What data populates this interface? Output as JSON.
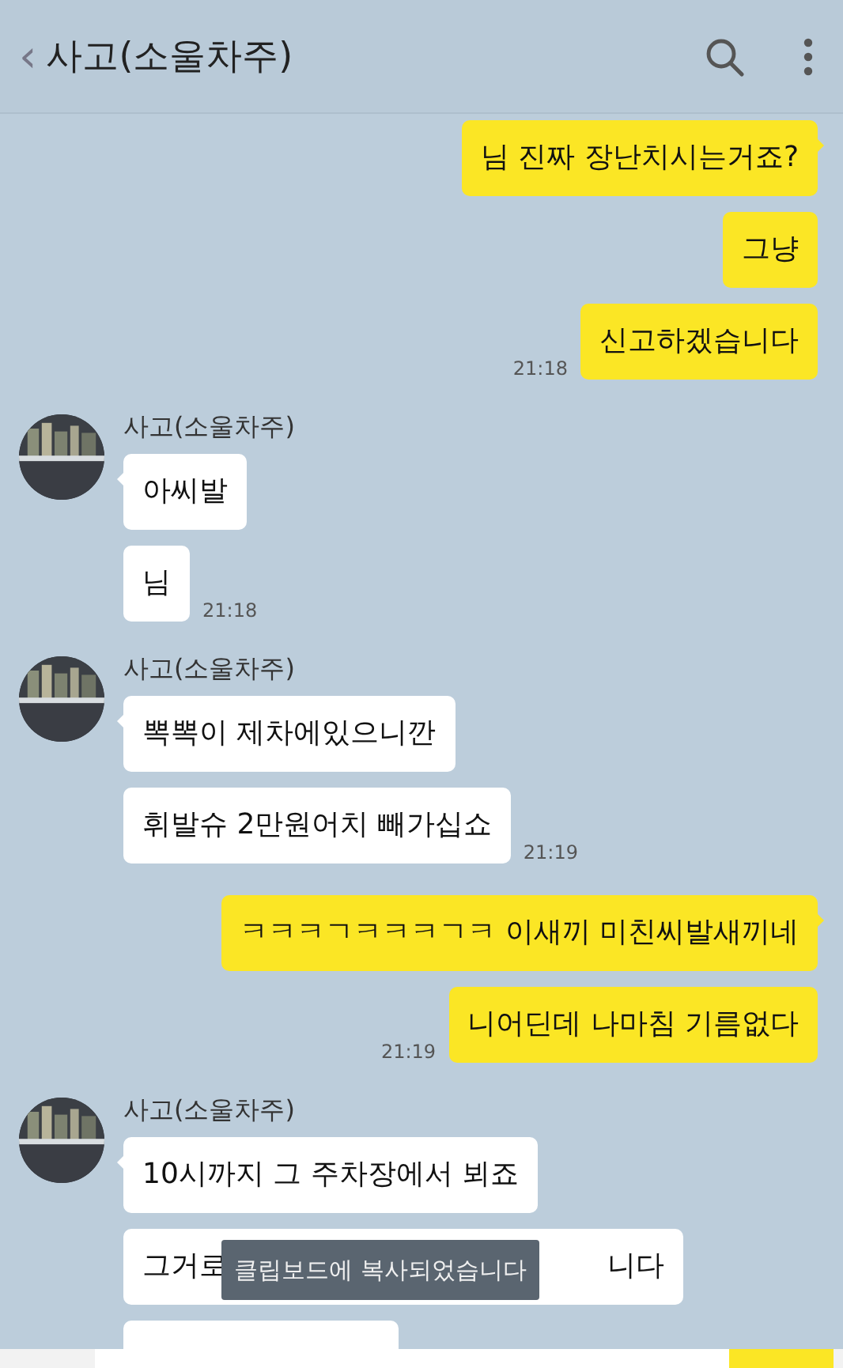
{
  "header": {
    "back": "‹",
    "title": "사고(소울차주)"
  },
  "chat": [
    {
      "kind": "sent",
      "messages": [
        {
          "text": "님 진짜 장난치시는거죠?"
        },
        {
          "text": "그냥"
        },
        {
          "text": "신고하겠습니다",
          "time": "21:18"
        }
      ]
    },
    {
      "kind": "received",
      "sender": "사고(소울차주)",
      "avatar": {
        "kind": "picture"
      },
      "messages": [
        {
          "text": "아씨발"
        },
        {
          "text": "님",
          "time": "21:18"
        }
      ]
    },
    {
      "kind": "received",
      "sender": "사고(소울차주)",
      "avatar": {
        "kind": "picture"
      },
      "messages": [
        {
          "text": "뽁뽁이 제차에있으니깐"
        },
        {
          "text": "휘발슈 2만원어치 빼가십쇼",
          "time": "21:19"
        }
      ]
    },
    {
      "kind": "sent",
      "messages": [
        {
          "text": "ㅋㅋㅋㄱㅋㅋㅋㄱㅋ 이새끼 미친씨발새끼네"
        },
        {
          "text": "니어딘데 나마침 기름없다",
          "time": "21:19"
        }
      ]
    },
    {
      "kind": "received",
      "sender": "사고(소울차주)",
      "avatar": {
        "kind": "picture"
      },
      "messages": [
        {
          "text": "10시까지 그 주차장에서 뵈죠"
        },
        {
          "text": "그거로",
          "text_after": "니다",
          "toast": "클립보드에 복사되었습니다"
        },
        {
          "kind": "cut"
        }
      ]
    }
  ]
}
